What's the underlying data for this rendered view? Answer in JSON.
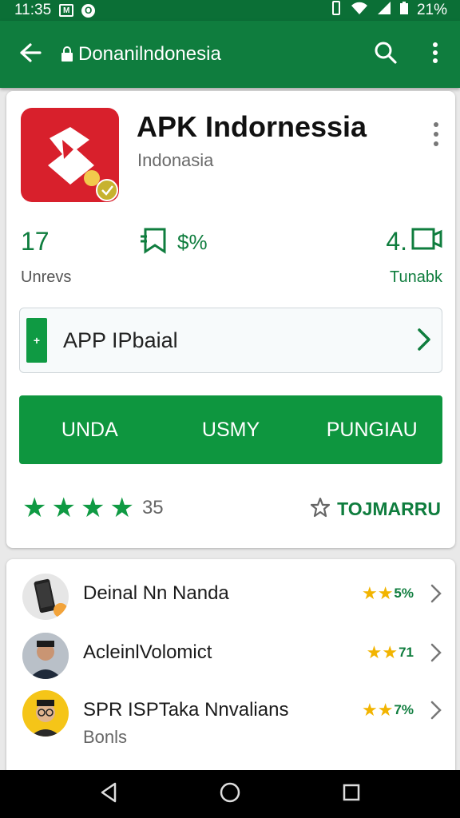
{
  "status_bar": {
    "time": "11:35",
    "box_icon_label": "M",
    "circle_icon_label": "O",
    "battery_text": "21%"
  },
  "app_bar": {
    "title": "Donanilndonesia"
  },
  "app": {
    "title": "APK Indornessia",
    "developer": "Indonasia",
    "stats": {
      "count": "17",
      "count_label": "Unrevs",
      "mid_text": "$%",
      "right_text": "4.",
      "right_label": "Tunabk"
    },
    "panel": {
      "tag": "+",
      "label": "APP IPbaial"
    },
    "actions": [
      "UNDA",
      "USMY",
      "PUNGIAU"
    ],
    "rating": {
      "stars": 4,
      "count": "35"
    },
    "wishlist_label": "TOJMARRU"
  },
  "list": [
    {
      "title": "Deinal Nn Nanda",
      "subtitle": "",
      "stars": 2,
      "rating_text": "5%",
      "avatar": "phone"
    },
    {
      "title": "AcleinlVolomict",
      "subtitle": "",
      "stars": 2,
      "rating_text": "71",
      "avatar": "man-suit"
    },
    {
      "title": "SPR ISPTaka Nnvalians",
      "subtitle": "Bonls",
      "stars": 2,
      "rating_text": "7%",
      "avatar": "man-glasses"
    }
  ],
  "colors": {
    "app_bar": "#0f7d3e",
    "status_bar": "#0b6f36",
    "accent": "#0e963f",
    "icon_red": "#d8202c",
    "star_yellow": "#f2b400"
  }
}
